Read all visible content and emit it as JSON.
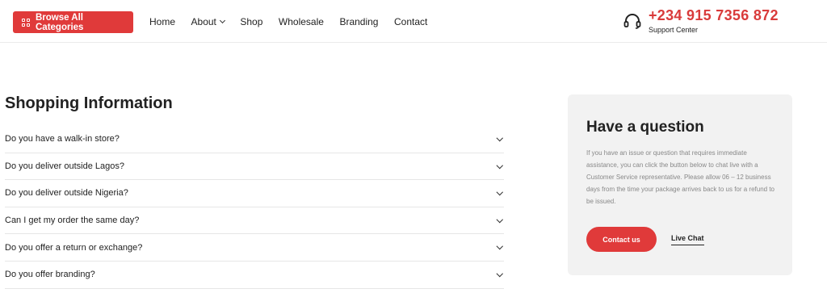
{
  "header": {
    "browse_label": "Browse All Categories",
    "nav": [
      {
        "label": "Home",
        "has_dropdown": false
      },
      {
        "label": "About",
        "has_dropdown": true
      },
      {
        "label": "Shop",
        "has_dropdown": false
      },
      {
        "label": "Wholesale",
        "has_dropdown": false
      },
      {
        "label": "Branding",
        "has_dropdown": false
      },
      {
        "label": "Contact",
        "has_dropdown": false
      }
    ],
    "phone": "+234 915 7356 872",
    "support_label": "Support Center",
    "icons": {
      "browse": "grid-icon",
      "support": "headset-icon",
      "dropdown": "chevron-down-icon"
    }
  },
  "faq": {
    "title": "Shopping Information",
    "items": [
      "Do you have a walk-in store?",
      "Do you deliver outside Lagos?",
      "Do you deliver outside Nigeria?",
      "Can I get my order the same day?",
      "Do you offer a return or exchange?",
      "Do you offer branding?"
    ]
  },
  "question": {
    "title": "Have a question",
    "body": "If you have an issue or question that requires immediate assistance, you can click the button below to chat live with a Customer Service representative. Please allow 06 – 12 business days from the time your package arrives back to us for a refund to be issued.",
    "contact_label": "Contact us",
    "live_chat_label": "Live Chat"
  },
  "colors": {
    "accent": "#e03a3a",
    "phone": "#d93b3b",
    "card_bg": "#f2f2f2"
  }
}
